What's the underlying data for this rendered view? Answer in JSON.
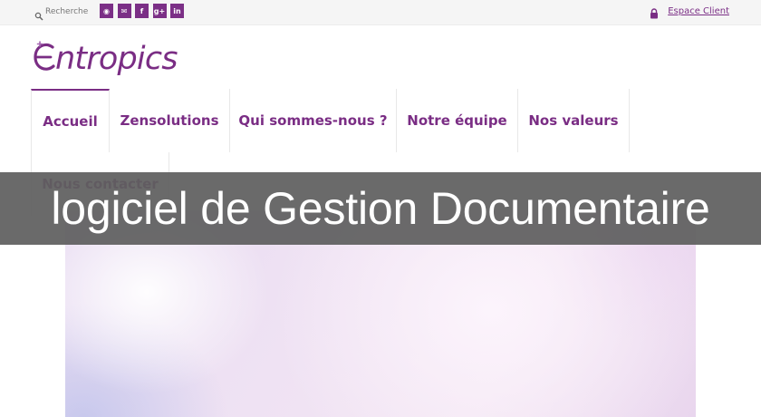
{
  "topbar": {
    "search": {
      "placeholder": "Recherche"
    },
    "socials": [
      {
        "icon": "rss-icon",
        "glyph": "◉"
      },
      {
        "icon": "mail-icon",
        "glyph": "✉"
      },
      {
        "icon": "facebook-icon",
        "glyph": "f"
      },
      {
        "icon": "google-plus-icon",
        "glyph": "g+"
      },
      {
        "icon": "linkedin-icon",
        "glyph": "in"
      }
    ],
    "client_label": "Espace Client"
  },
  "logo": {
    "text": "ntropics"
  },
  "nav": {
    "items": [
      {
        "label": "Accueil",
        "active": true
      },
      {
        "label": "Zensolutions"
      },
      {
        "label": "Qui sommes-nous ?"
      },
      {
        "label": "Notre équipe"
      },
      {
        "label": "Nos valeurs"
      },
      {
        "label": "Nous contacter"
      }
    ]
  },
  "banner": {
    "title": "logiciel de Gestion Documentaire"
  },
  "colors": {
    "brand": "#7a2d84",
    "banner_bg": "#5f5f5f"
  }
}
